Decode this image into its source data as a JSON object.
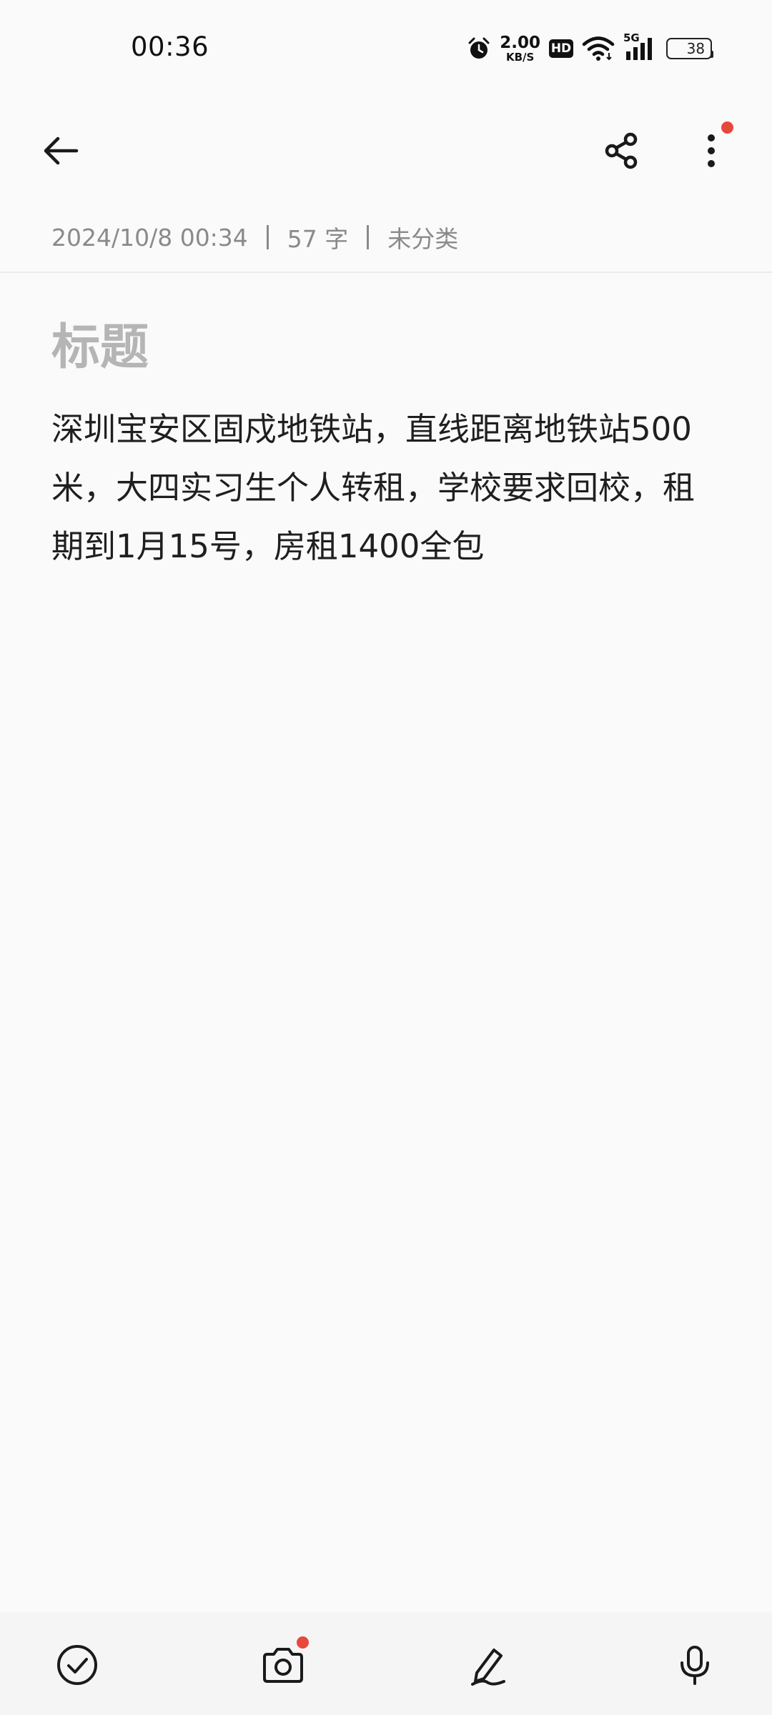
{
  "status_bar": {
    "time": "00:36",
    "net_speed_value": "2.00",
    "net_speed_unit": "KB/S",
    "hd_label": "HD",
    "network_label": "5G",
    "battery_level": "38",
    "icons": [
      "alarm-icon",
      "hd-icon",
      "wifi-icon",
      "cellular-signal-icon",
      "battery-icon"
    ]
  },
  "top_bar": {
    "icons": [
      "back-arrow-icon",
      "share-icon",
      "more-vertical-icon"
    ]
  },
  "meta": {
    "datetime": "2024/10/8 00:34",
    "char_count": "57 字",
    "category": "未分类"
  },
  "note": {
    "title_placeholder": "标题",
    "content": "深圳宝安区固戍地铁站，直线距离地铁站500米，大四实习生个人转租，学校要求回校，租期到1月15号，房租1400全包"
  },
  "bottom_bar": {
    "icons": [
      "checklist-icon",
      "camera-icon",
      "handwriting-pen-icon",
      "microphone-icon"
    ]
  },
  "colors": {
    "background": "#fafafa",
    "text": "#1f1f1f",
    "meta_text": "#8a8a8a",
    "title_placeholder": "#b5b5b5",
    "notification_dot": "#e8473c",
    "toolbar_bg": "#f5f5f5"
  }
}
